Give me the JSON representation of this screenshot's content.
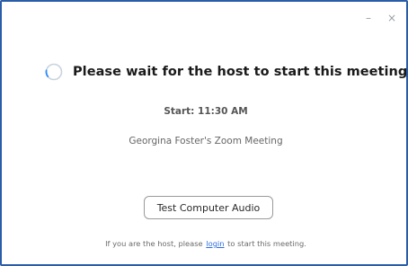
{
  "window": {
    "minimize_glyph": "–",
    "close_glyph": "×"
  },
  "status": {
    "icon": "loading-spinner-icon",
    "message": "Please wait for the host to start this meeting."
  },
  "meeting": {
    "start_time": "Start: 11:30 AM",
    "name": "Georgina Foster's Zoom Meeting"
  },
  "actions": {
    "test_audio_label": "Test Computer Audio"
  },
  "footer": {
    "prefix": "If you are the host, please",
    "login_link": "login",
    "suffix": "to start this meeting."
  },
  "colors": {
    "window_border": "#2a5da8",
    "spinner_active": "#2d8cff",
    "spinner_track": "#c9d3de",
    "link": "#2d6cdf"
  }
}
